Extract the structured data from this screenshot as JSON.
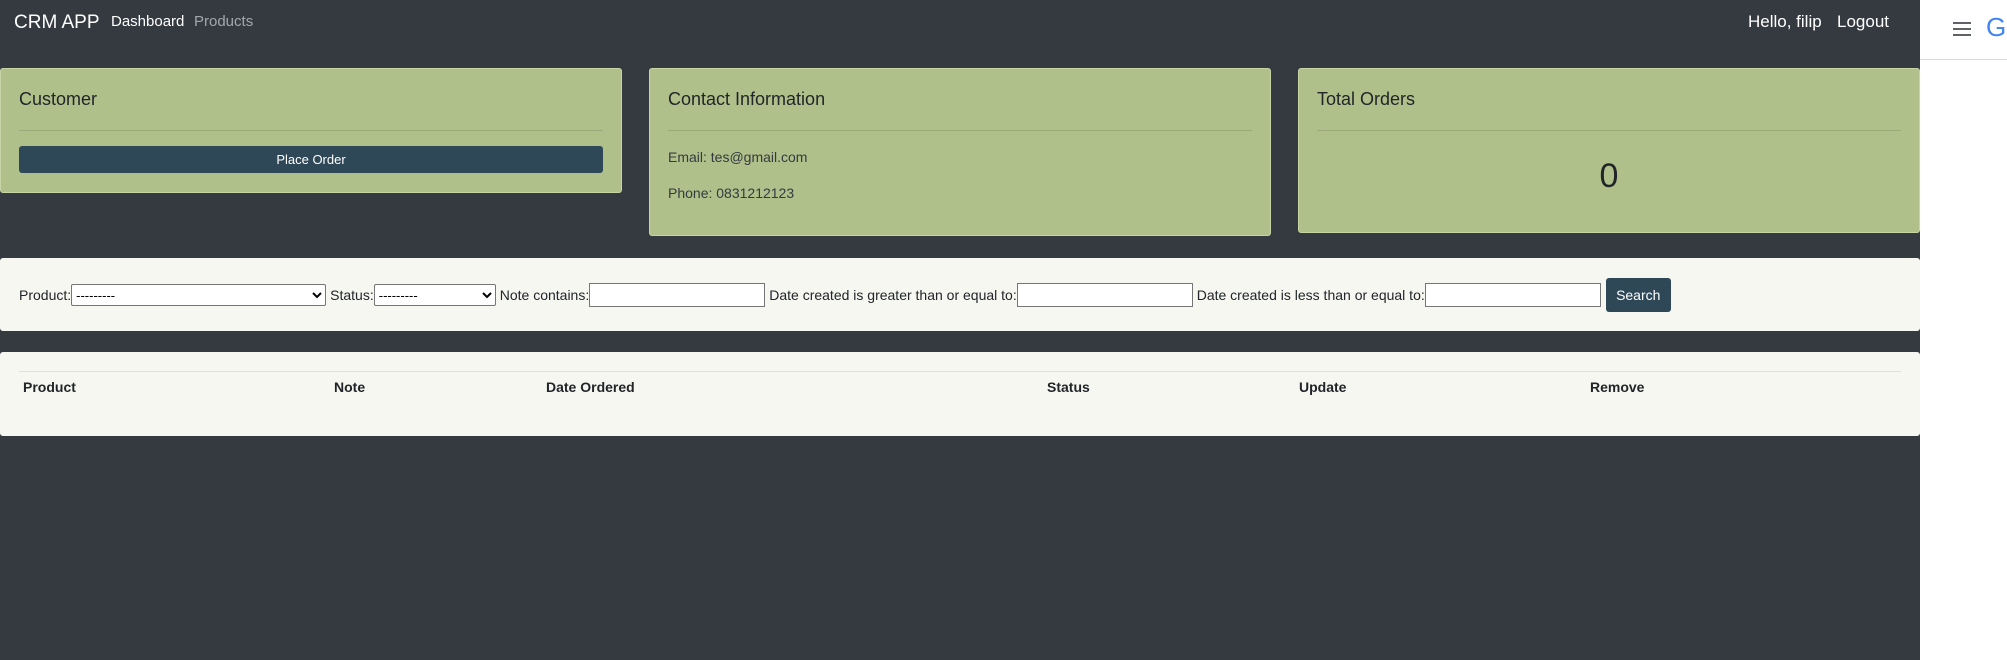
{
  "navbar": {
    "brand": "CRM APP",
    "links": [
      {
        "label": "Dashboard"
      },
      {
        "label": "Products"
      }
    ],
    "greeting": "Hello, filip",
    "logout": "Logout"
  },
  "cards": {
    "customer": {
      "title": "Customer",
      "button": "Place Order"
    },
    "contact": {
      "title": "Contact Information",
      "email": "Email: tes@gmail.com",
      "phone": "Phone: 0831212123"
    },
    "orders": {
      "title": "Total Orders",
      "count": "0"
    }
  },
  "filter": {
    "product_label": "Product:",
    "product_value": "---------",
    "status_label": "Status:",
    "status_value": "---------",
    "note_label": "Note contains:",
    "note_value": "",
    "date_gte_label": "Date created is greater than or equal to:",
    "date_gte_value": "",
    "date_lte_label": "Date created is less than or equal to:",
    "date_lte_value": "",
    "search_button": "Search"
  },
  "orders_table": {
    "columns": [
      "Product",
      "Note",
      "Date Ordered",
      "Status",
      "Update",
      "Remove"
    ],
    "rows": []
  },
  "side_panel": {
    "menu_icon": "hamburger-icon",
    "logo_text": "Go"
  },
  "colors": {
    "background": "#343a40",
    "card": "#b0c08b",
    "button": "#2f4858",
    "panel": "#f6f7f0"
  }
}
